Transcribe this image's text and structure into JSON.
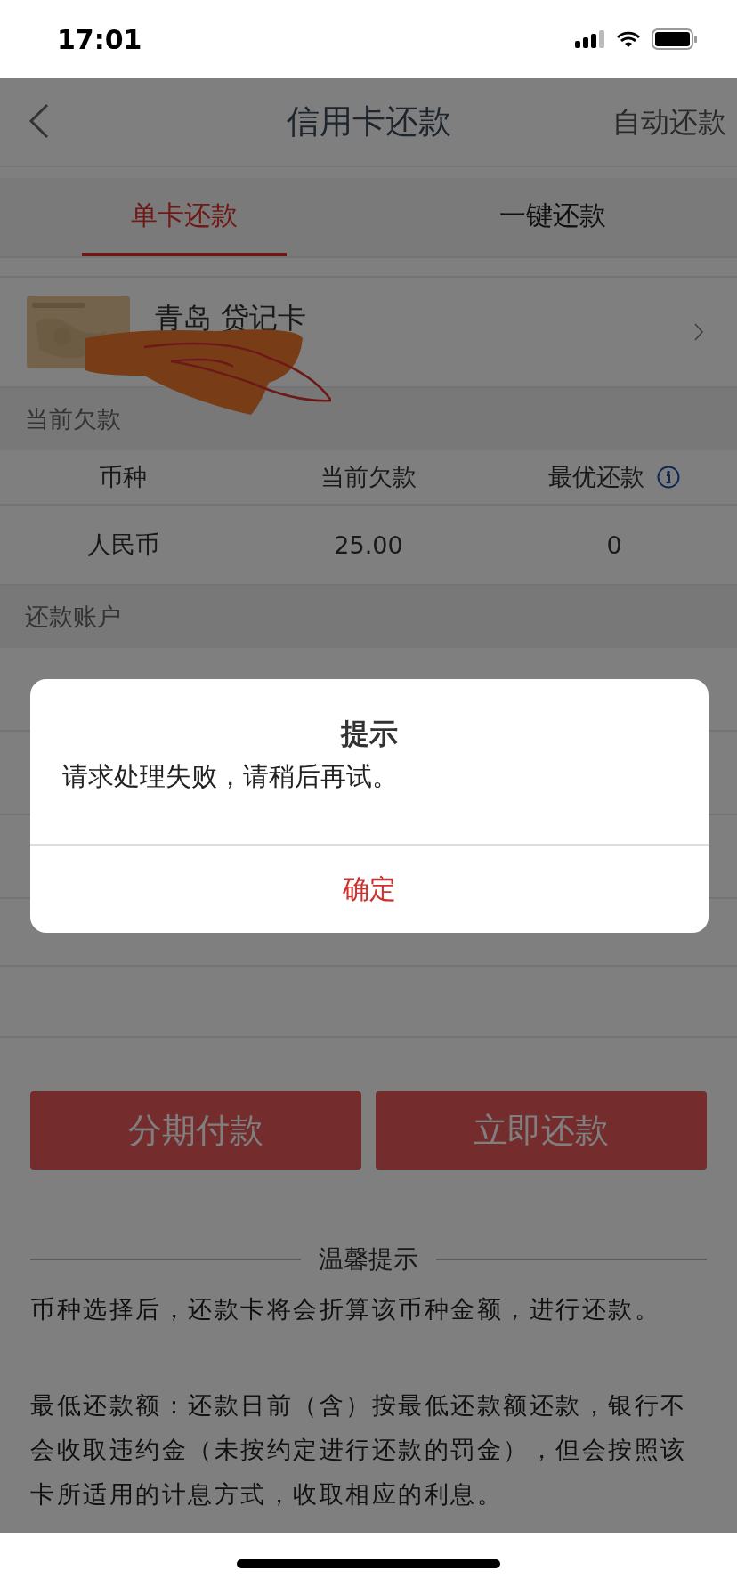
{
  "status_bar": {
    "time": "17:01"
  },
  "nav": {
    "title": "信用卡还款",
    "action": "自动还款"
  },
  "tabs": [
    {
      "label": "单卡还款",
      "selected": true
    },
    {
      "label": "一键还款",
      "selected": false
    }
  ],
  "card": {
    "name": "青岛 贷记卡"
  },
  "debt_section": {
    "title": "当前欠款",
    "columns": [
      "币种",
      "当前欠款",
      "最优还款"
    ],
    "rows": [
      [
        "人民币",
        "25.00",
        "0"
      ]
    ]
  },
  "account_section": {
    "title": "还款账户"
  },
  "buttons": [
    "分期付款",
    "立即还款"
  ],
  "tips": {
    "title": "温馨提示",
    "paragraphs": [
      "币种选择后，还款卡将会折算该币种金额，进行还款。",
      "最低还款额：还款日前（含）按最低还款额还款，银行不会收取违约金（未按约定进行还款的罚金），但会按照该卡所适用的计息方式，收取相应的利息。"
    ]
  },
  "dialog": {
    "title": "提示",
    "message": "请求处理失败，请稍后再试。",
    "button": "确定"
  }
}
